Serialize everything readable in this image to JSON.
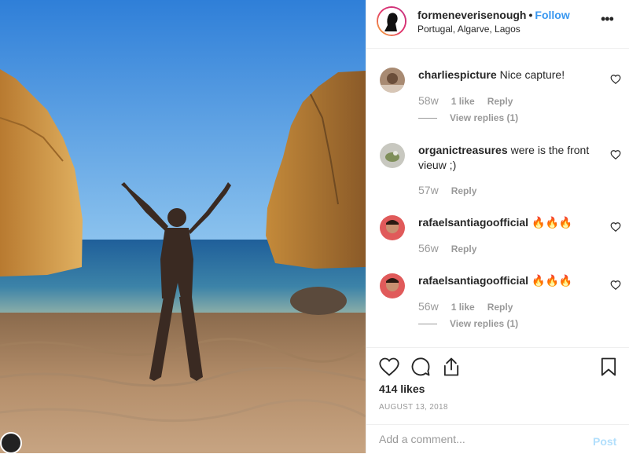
{
  "post": {
    "username": "formeneverisenough",
    "separator": "•",
    "follow_label": "Follow",
    "location": "Portugal, Algarve, Lagos",
    "more_icon": "more-options-icon",
    "more_label": "•••"
  },
  "comments": [
    {
      "user": "charliespicture",
      "text": "Nice capture!",
      "age": "58w",
      "likes": "1 like",
      "reply": "Reply",
      "view_replies": "View replies (1)"
    },
    {
      "user": "organictreasures",
      "text": "were is the front vieuw ;)",
      "age": "57w",
      "reply": "Reply"
    },
    {
      "user": "rafaelsantiagoofficial",
      "text": "🔥🔥🔥",
      "age": "56w",
      "reply": "Reply"
    },
    {
      "user": "rafaelsantiagoofficial",
      "text": "🔥🔥🔥",
      "age": "56w",
      "likes": "1 like",
      "reply": "Reply",
      "view_replies": "View replies (1)"
    }
  ],
  "actions": {
    "likes": "414 likes",
    "date": "AUGUST 13, 2018",
    "comment_placeholder": "Add a comment...",
    "post_label": "Post"
  },
  "colors": {
    "link": "#3897f0",
    "post_disabled": "#b2dffc",
    "muted": "#999999"
  }
}
